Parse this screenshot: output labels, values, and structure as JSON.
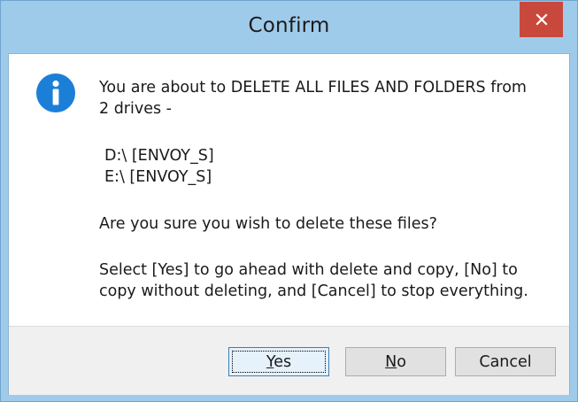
{
  "window": {
    "title": "Confirm",
    "close_icon": "close-icon",
    "accent_close": "#c9483c",
    "frame_color": "#9fcbeb"
  },
  "message": {
    "icon": "info-icon",
    "line1": "You are about to DELETE ALL FILES AND FOLDERS from",
    "line2": "2 drives -",
    "drives": [
      "D:\\  [ENVOY_S]",
      "E:\\  [ENVOY_S]"
    ],
    "question": "Are you sure you wish to delete these files?",
    "instruction_line1": "Select [Yes] to go ahead with delete and copy, [No] to",
    "instruction_line2": "copy without deleting, and [Cancel] to stop everything."
  },
  "buttons": {
    "yes": {
      "mnemonic": "Y",
      "rest": "es"
    },
    "no": {
      "mnemonic": "N",
      "rest": "o"
    },
    "cancel": {
      "label": "Cancel"
    }
  }
}
